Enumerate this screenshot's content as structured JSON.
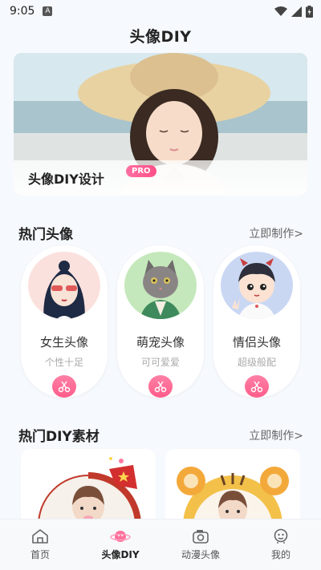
{
  "status_bar": {
    "time": "9:05",
    "notif_letter": "A"
  },
  "page": {
    "title": "头像DIY"
  },
  "banner": {
    "title": "头像DIY设计",
    "badge": "PRO"
  },
  "hot_avatars": {
    "title": "热门头像",
    "link": "立即制作>",
    "items": [
      {
        "name": "女生头像",
        "sub": "个性十足"
      },
      {
        "name": "萌宠头像",
        "sub": "可可爱爱"
      },
      {
        "name": "情侣头像",
        "sub": "超级般配"
      }
    ]
  },
  "hot_materials": {
    "title": "热门DIY素材",
    "link": "立即制作>"
  },
  "tabbar": {
    "items": [
      {
        "label": "首页",
        "icon": "home-icon"
      },
      {
        "label": "头像DIY",
        "icon": "planet-icon"
      },
      {
        "label": "动漫头像",
        "icon": "camera-icon"
      },
      {
        "label": "我的",
        "icon": "user-face-icon"
      }
    ],
    "active_index": 1
  },
  "colors": {
    "accent_pink": "#ff5c8a",
    "background": "#f6f9fd"
  }
}
